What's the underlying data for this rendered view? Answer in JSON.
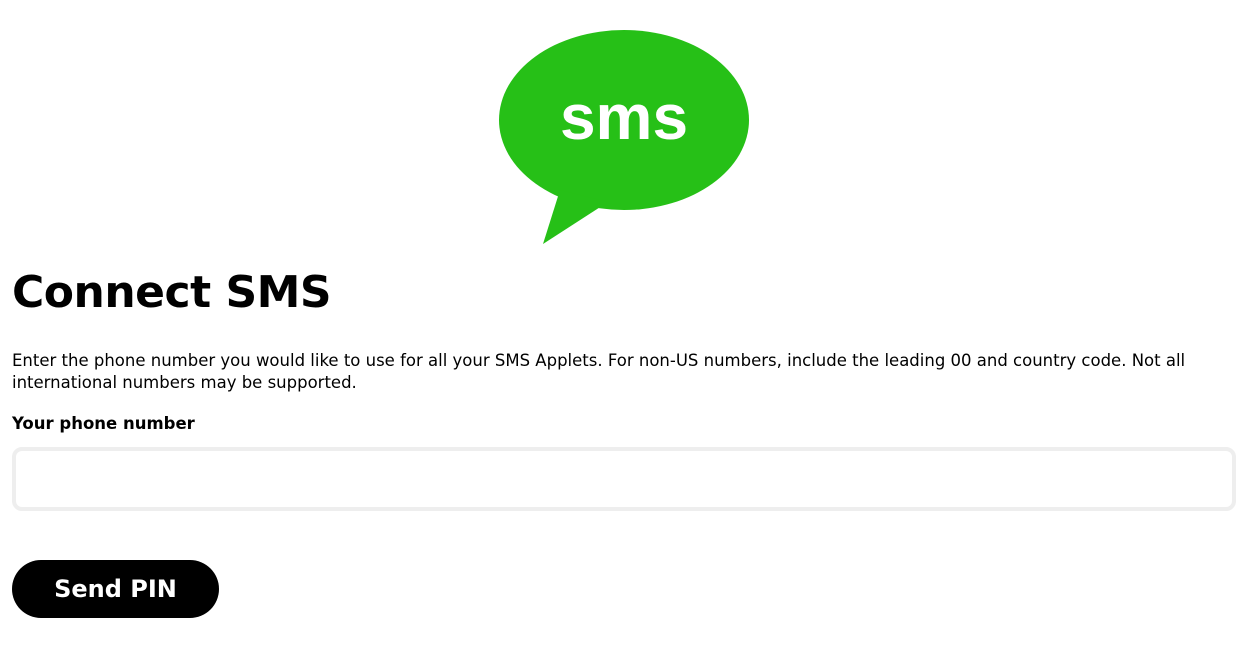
{
  "logo": {
    "text": "sms",
    "icon": "sms-speech-bubble-icon",
    "color": "#26c017"
  },
  "page": {
    "title": "Connect SMS",
    "description": "Enter the phone number you would like to use for all your SMS Applets. For non-US numbers, include the leading 00 and country code. Not all international numbers may be supported."
  },
  "form": {
    "phone_label": "Your phone number",
    "phone_value": "",
    "phone_placeholder": "",
    "submit_label": "Send PIN"
  },
  "colors": {
    "input_border": "#eeeeee",
    "button_background": "#000000",
    "button_text": "#ffffff"
  }
}
